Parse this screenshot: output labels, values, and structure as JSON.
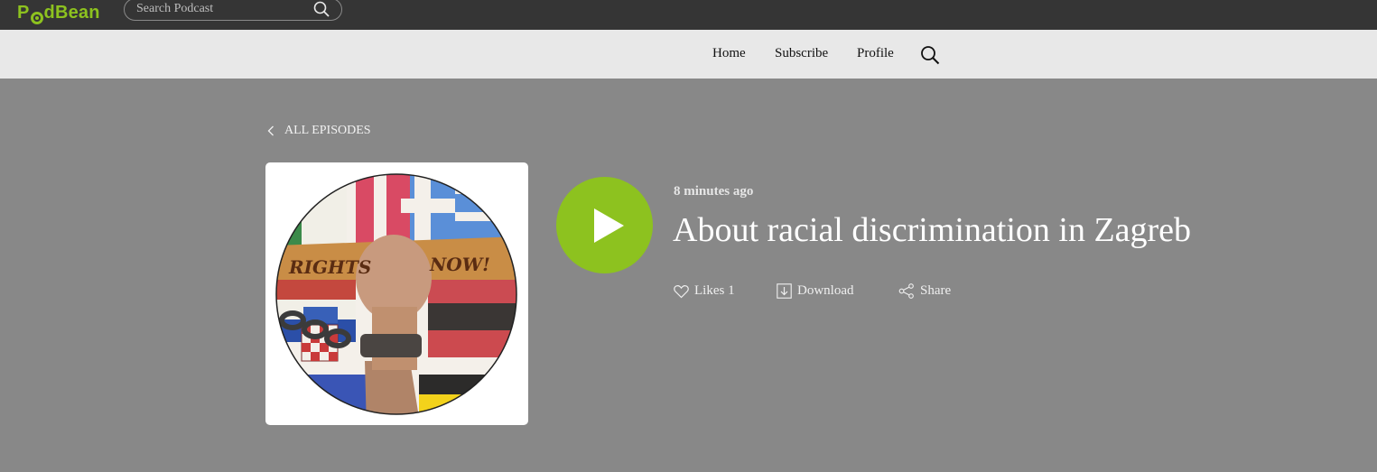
{
  "header": {
    "logo_text_pre": "P",
    "logo_text_post": "dBean",
    "search_placeholder": "Search Podcast"
  },
  "nav": {
    "home": "Home",
    "subscribe": "Subscribe",
    "profile": "Profile"
  },
  "episode": {
    "back_label": "ALL EPISODES",
    "time_ago": "8 minutes ago",
    "title": "About racial discrimination in Zagreb",
    "likes_label": "Likes 1",
    "download_label": "Download",
    "share_label": "Share",
    "artwork_text_left": "RIGHTS",
    "artwork_text_right": "NOW!"
  },
  "colors": {
    "brand_green": "#8dc21f",
    "topbar_bg": "#353535",
    "nav_bg": "#e8e8e8",
    "page_bg": "#888888"
  },
  "icons": [
    "search-icon",
    "chevron-left-icon",
    "play-icon",
    "heart-icon",
    "download-icon",
    "share-icon"
  ]
}
